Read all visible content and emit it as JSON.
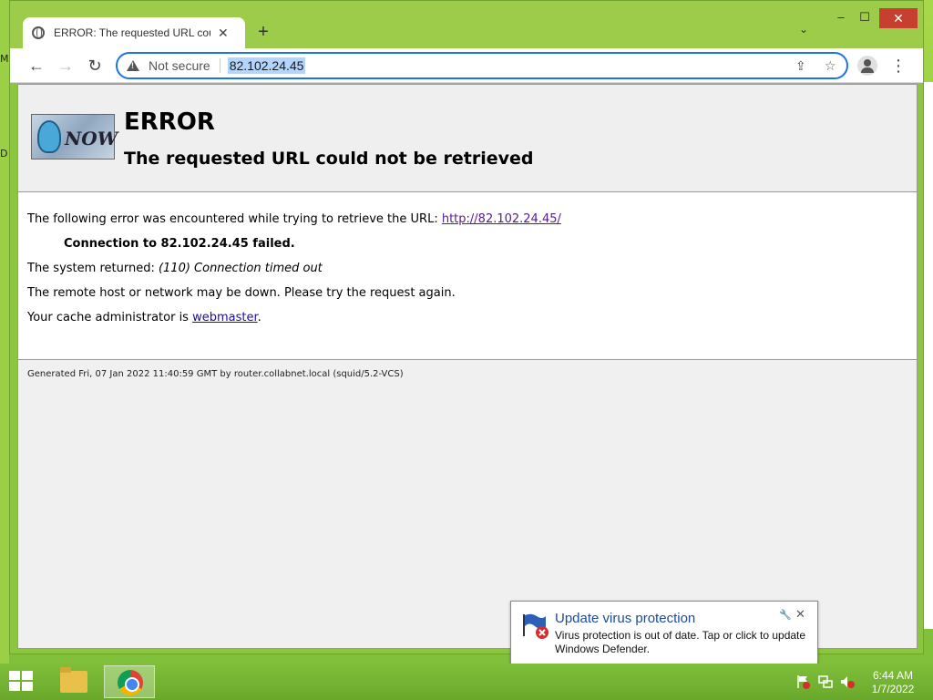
{
  "desktop": {
    "left_marks": [
      "M",
      "D"
    ]
  },
  "browser": {
    "tab": {
      "title": "ERROR: The requested URL could not be retrieved",
      "close": "✕"
    },
    "new_tab": "+",
    "tab_search": "⌄",
    "window_controls": {
      "minimize": "–",
      "maximize": "☐",
      "close": "✕"
    },
    "toolbar": {
      "back": "←",
      "forward": "→",
      "reload": "↻",
      "security_label": "Not secure",
      "url": "82.102.24.45",
      "share_icon": "⇪",
      "bookmark_icon": "☆",
      "menu": "⋮"
    }
  },
  "page": {
    "error_title": "ERROR",
    "error_subtitle": "The requested URL could not be retrieved",
    "logo_text": "NOW",
    "line1_prefix": "The following error was encountered while trying to retrieve the URL: ",
    "line1_link": "http://82.102.24.45/",
    "line2": "Connection to 82.102.24.45 failed.",
    "line3_prefix": "The system returned: ",
    "line3_italic": "(110) Connection timed out",
    "line4": "The remote host or network may be down. Please try the request again.",
    "line5_prefix": "Your cache administrator is ",
    "line5_link": "webmaster",
    "line5_suffix": ".",
    "footer": "Generated Fri, 07 Jan 2022 11:40:59 GMT by router.collabnet.local (squid/5.2-VCS)"
  },
  "notification": {
    "title": "Update virus protection",
    "message": "Virus protection is out of date. Tap or click to update Windows Defender.",
    "pin": "🔧",
    "close": "✕"
  },
  "taskbar": {
    "clock_time": "6:44 AM",
    "clock_date": "1/7/2022"
  }
}
